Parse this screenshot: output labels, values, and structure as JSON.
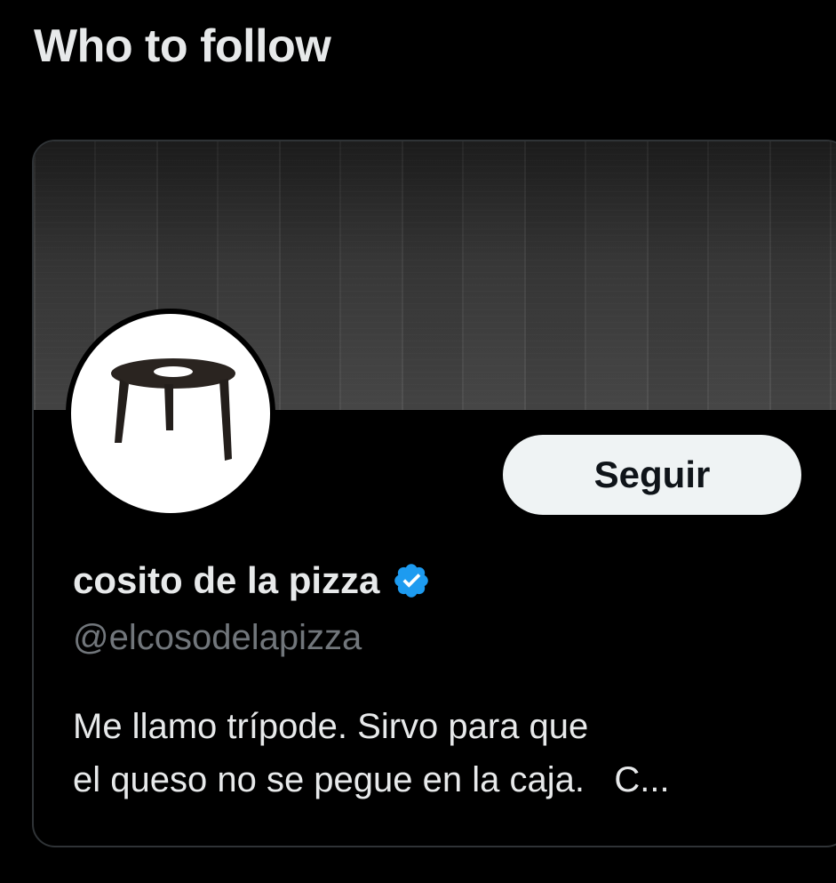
{
  "section": {
    "title": "Who to follow"
  },
  "card": {
    "display_name": "cosito de la pizza",
    "handle": "@elcosodelapizza",
    "verified": true,
    "follow_label": "Seguir",
    "bio_lines": [
      "Me llamo trípode. Sirvo para que",
      "el queso no se pegue en la caja.   C..."
    ],
    "avatar_icon": "pizza-saver-tripod-icon",
    "banner": "dark-wood-texture"
  },
  "colors": {
    "background": "#000000",
    "primary_text": "#e7e9ea",
    "secondary_text": "#71767b",
    "border": "#2f3336",
    "button_bg": "#eff3f4",
    "button_text": "#0f1419",
    "verified_blue": "#1d9bf0"
  }
}
